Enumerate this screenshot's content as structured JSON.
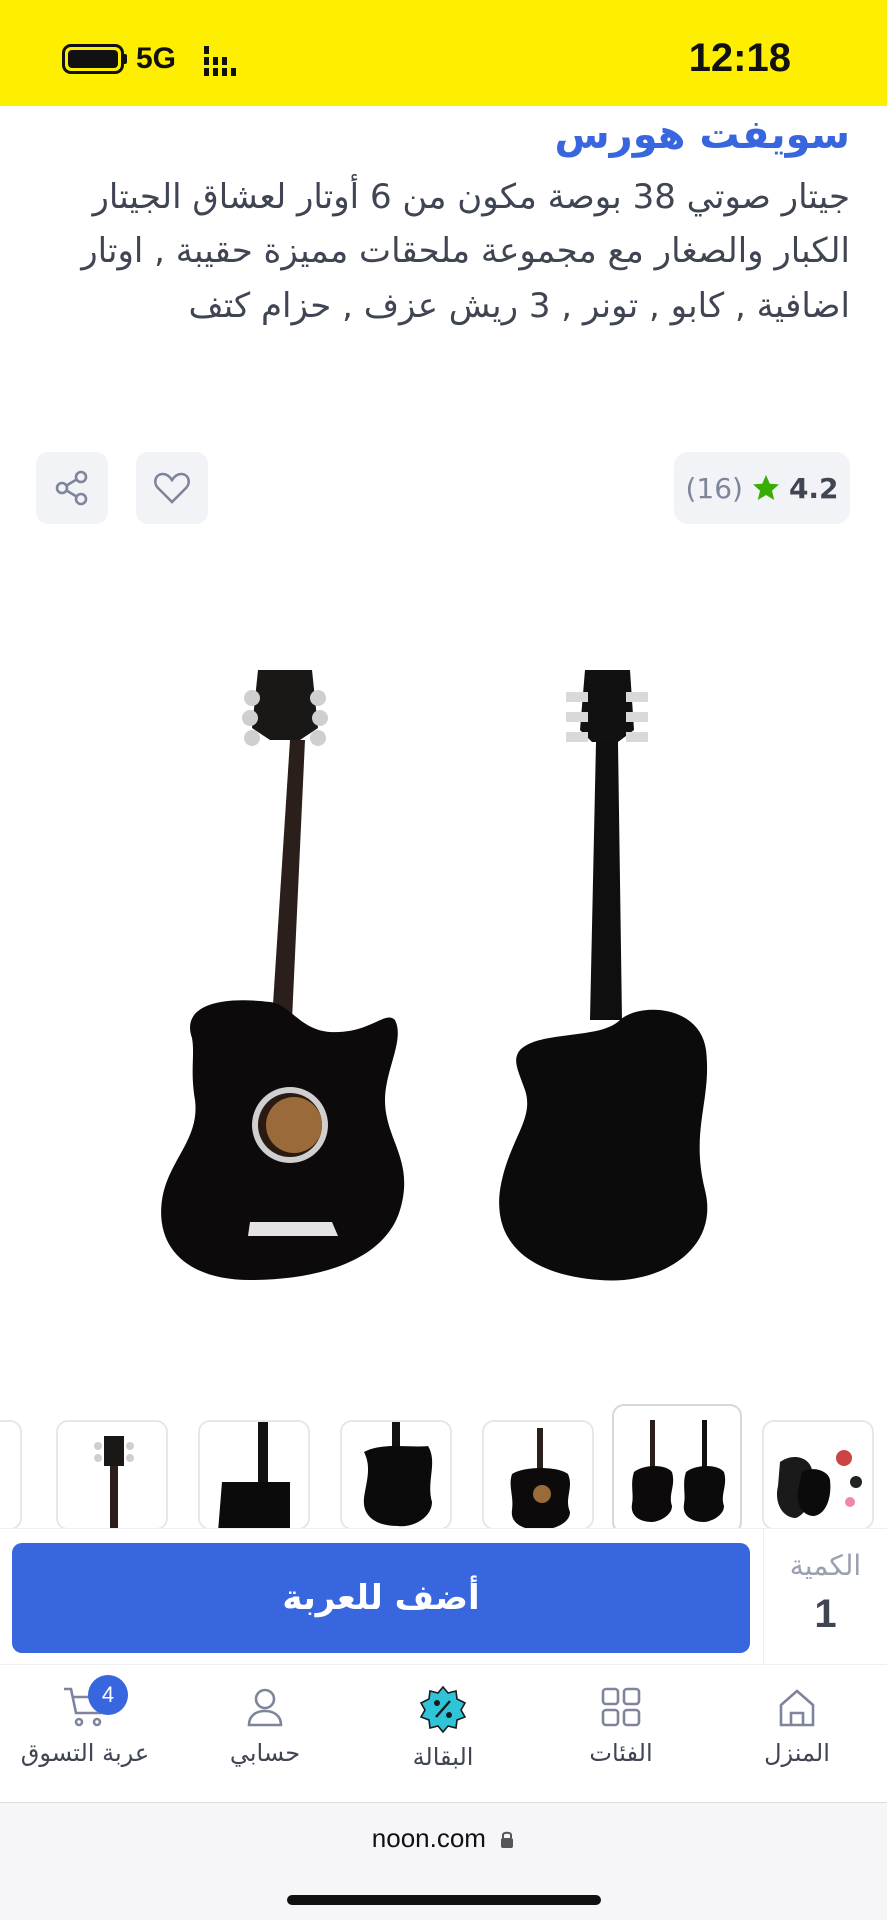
{
  "status_bar": {
    "network": "5G",
    "time": "12:18"
  },
  "product": {
    "brand": "سويفت هورس",
    "title": "جيتار صوتي 38 بوصة مكون من 6 أوتار لعشاق الجيتار الكبار والصغار مع مجموعة ملحقات مميزة حقيبة , اوتار اضافية , كابو , تونر , 3 ريش عزف , حزام كتف",
    "rating": "4.2",
    "review_count": "(16)"
  },
  "icons": {
    "share": "share-icon",
    "wishlist": "heart-icon",
    "star": "star-icon",
    "lock": "lock-icon"
  },
  "gallery": {
    "thumbnail_count": 7,
    "selected_index": 1
  },
  "cart_bar": {
    "add_to_cart_label": "أضف للعربة",
    "quantity_label": "الكمية",
    "quantity_value": "1"
  },
  "bottom_nav": {
    "home": "المنزل",
    "categories": "الفئات",
    "grocery": "البقالة",
    "account": "حسابي",
    "cart": "عربة التسوق",
    "cart_count": "4"
  },
  "browser": {
    "url": "noon.com"
  },
  "colors": {
    "brand_yellow": "#feee00",
    "primary_blue": "#3866df",
    "rating_green": "#38ae04",
    "text": "#404553"
  }
}
